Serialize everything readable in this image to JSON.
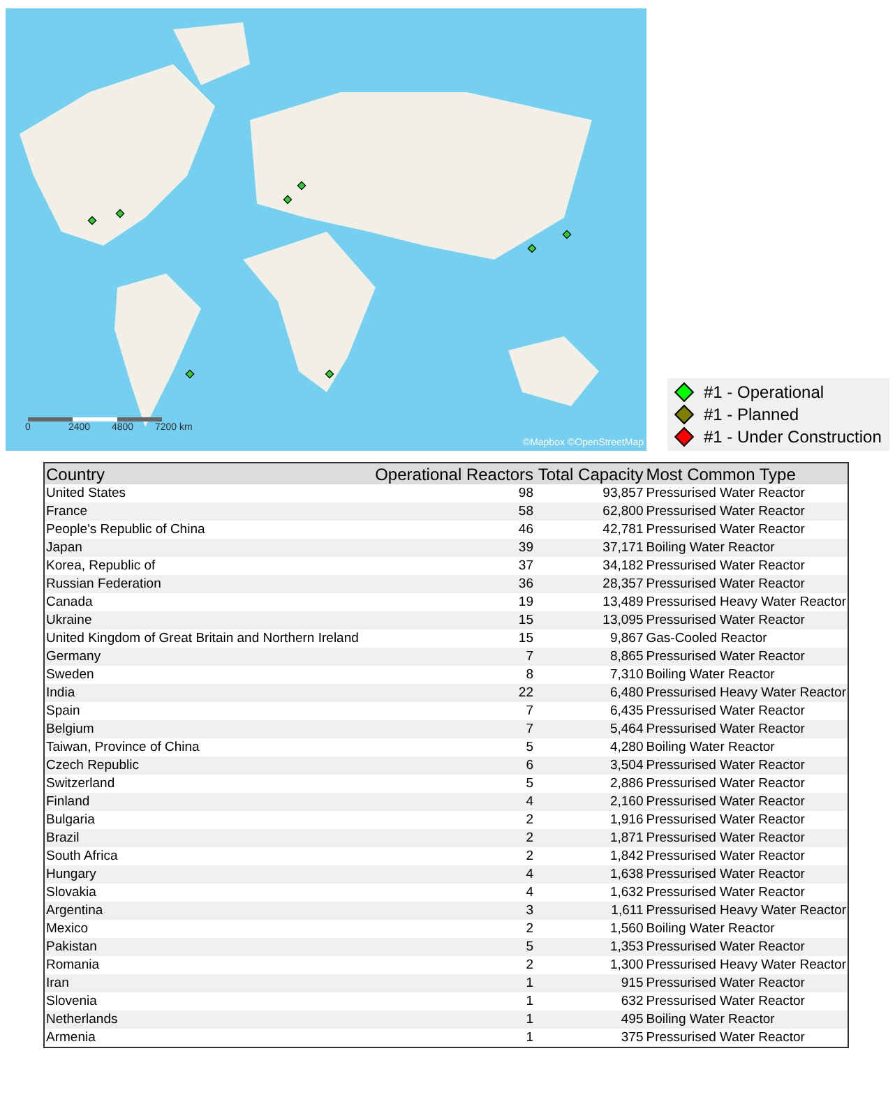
{
  "map": {
    "scale_labels": [
      "0",
      "2400",
      "4800",
      "7200 km"
    ],
    "attribution": "©Mapbox ©OpenStreetMap"
  },
  "legend": [
    {
      "label": "#1 - Operational",
      "color": "#00ff00"
    },
    {
      "label": "#1 - Planned",
      "color": "#808000"
    },
    {
      "label": "#1 - Under Construction",
      "color": "#ff0000"
    }
  ],
  "table": {
    "columns": [
      "Country",
      "Operational Reactors",
      "Total Capacity",
      "Most Common Type"
    ],
    "rows": [
      [
        "United States",
        "98",
        "93,857",
        "Pressurised Water Reactor"
      ],
      [
        "France",
        "58",
        "62,800",
        "Pressurised Water Reactor"
      ],
      [
        "People's Republic of China",
        "46",
        "42,781",
        "Pressurised Water Reactor"
      ],
      [
        "Japan",
        "39",
        "37,171",
        "Boiling Water Reactor"
      ],
      [
        "Korea, Republic of",
        "37",
        "34,182",
        "Pressurised Water Reactor"
      ],
      [
        "Russian Federation",
        "36",
        "28,357",
        "Pressurised Water Reactor"
      ],
      [
        "Canada",
        "19",
        "13,489",
        "Pressurised Heavy Water Reactor"
      ],
      [
        "Ukraine",
        "15",
        "13,095",
        "Pressurised Water Reactor"
      ],
      [
        "United Kingdom of Great Britain and Northern Ireland",
        "15",
        "9,867",
        "Gas-Cooled Reactor"
      ],
      [
        "Germany",
        "7",
        "8,865",
        "Pressurised Water Reactor"
      ],
      [
        "Sweden",
        "8",
        "7,310",
        "Boiling Water Reactor"
      ],
      [
        "India",
        "22",
        "6,480",
        "Pressurised Heavy Water Reactor"
      ],
      [
        "Spain",
        "7",
        "6,435",
        "Pressurised Water Reactor"
      ],
      [
        "Belgium",
        "7",
        "5,464",
        "Pressurised Water Reactor"
      ],
      [
        "Taiwan, Province of China",
        "5",
        "4,280",
        "Boiling Water Reactor"
      ],
      [
        "Czech Republic",
        "6",
        "3,504",
        "Pressurised Water Reactor"
      ],
      [
        "Switzerland",
        "5",
        "2,886",
        "Pressurised Water Reactor"
      ],
      [
        "Finland",
        "4",
        "2,160",
        "Pressurised Water Reactor"
      ],
      [
        "Bulgaria",
        "2",
        "1,916",
        "Pressurised Water Reactor"
      ],
      [
        "Brazil",
        "2",
        "1,871",
        "Pressurised Water Reactor"
      ],
      [
        "South Africa",
        "2",
        "1,842",
        "Pressurised Water Reactor"
      ],
      [
        "Hungary",
        "4",
        "1,638",
        "Pressurised Water Reactor"
      ],
      [
        "Slovakia",
        "4",
        "1,632",
        "Pressurised Water Reactor"
      ],
      [
        "Argentina",
        "3",
        "1,611",
        "Pressurised Heavy Water Reactor"
      ],
      [
        "Mexico",
        "2",
        "1,560",
        "Boiling Water Reactor"
      ],
      [
        "Pakistan",
        "5",
        "1,353",
        "Pressurised Water Reactor"
      ],
      [
        "Romania",
        "2",
        "1,300",
        "Pressurised Heavy Water Reactor"
      ],
      [
        "Iran",
        "1",
        "915",
        "Pressurised Water Reactor"
      ],
      [
        "Slovenia",
        "1",
        "632",
        "Pressurised Water Reactor"
      ],
      [
        "Netherlands",
        "1",
        "495",
        "Boiling Water Reactor"
      ],
      [
        "Armenia",
        "1",
        "375",
        "Pressurised Water Reactor"
      ]
    ]
  }
}
